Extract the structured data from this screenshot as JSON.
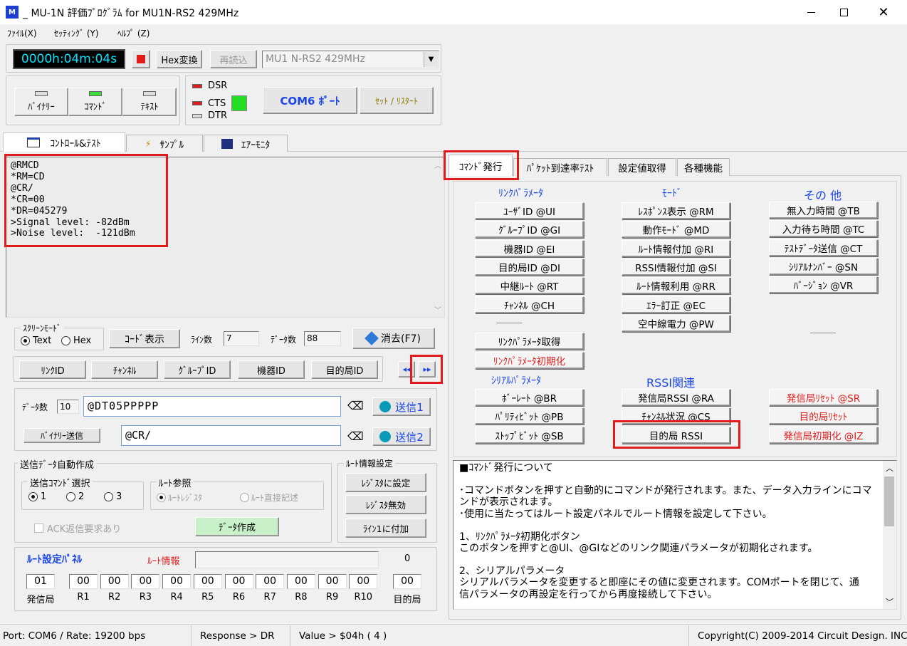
{
  "title_bar": {
    "title": "_ MU-1N 評価ﾌﾟﾛｸﾞﾗﾑ for MU1N-RS2 429MHz"
  },
  "menu": [
    "ﾌｧｲﾙ(X)",
    "ｾｯﾃｨﾝｸﾞ (Y)",
    "ﾍﾙﾌﾟ (Z)"
  ],
  "toolbar": {
    "timer": "0000h:04m:04s",
    "hex_button": "Hex変換",
    "reload_button": "再読込",
    "device_select": "MU1 N-RS2 429MHz"
  },
  "mode_buttons": [
    "ﾊﾞｲﾅﾘｰ",
    "ｺﾏﾝﾄﾞ",
    "ﾃｷｽﾄ"
  ],
  "signals": {
    "dsr": "DSR",
    "cts": "CTS",
    "dtr": "DTR"
  },
  "com": {
    "port_button": "COM6 ﾎﾟｰﾄ",
    "reset_button": "ｾｯﾄ / ﾘｽﾀｰﾄ"
  },
  "main_tabs": [
    "ｺﾝﾄﾛｰﾙ&ﾃｽﾄ",
    "ｻﾝﾌﾟﾙ",
    "ｴｱｰﾓﾆﾀ"
  ],
  "console": {
    "lines": [
      "@RMCD",
      "*RM=CD",
      "@CR/",
      "*CR=00",
      "*DR=045279",
      ">Signal level: -82dBm",
      ">Noise level:  -121dBm"
    ]
  },
  "screen_mode": {
    "title": "ｽｸﾘｰﾝﾓｰﾄﾞ",
    "text": "Text",
    "hex": "Hex",
    "code_button": "ｺｰﾄﾞ表示",
    "lines_label": "ﾗｲﾝ数",
    "lines_value": "7",
    "data_label": "ﾃﾞｰﾀ数",
    "data_value": "88",
    "clear_button": "消去(F7)"
  },
  "quick_buttons": [
    "ﾘﾝｸID",
    "ﾁｬﾝﾈﾙ",
    "ｸﾞﾙｰﾌﾟID",
    "機器ID",
    "目的局ID"
  ],
  "nav": {
    "prev": "◂◂",
    "next": "▸▸"
  },
  "send": {
    "count_label": "ﾃﾞｰﾀ数",
    "count_value": "10",
    "input1": "@DT05PPPPP",
    "send1": "送信1",
    "binary_button": "ﾊﾞｲﾅﾘｰ送信",
    "input2": "@CR/",
    "send2": "送信2"
  },
  "auto": {
    "title": "送信ﾃﾞｰﾀ自動作成",
    "cmd_title": "送信ｺﾏﾝﾄﾞ選択",
    "opts": [
      "1",
      "2",
      "3"
    ],
    "route_title": "ﾙｰﾄ参照",
    "route_opt1": "ﾙｰﾄﾚｼﾞｽﾀ",
    "route_opt2": "ﾙｰﾄ直接記述",
    "ack": "ACK返信要求あり",
    "make_button": "ﾃﾞｰﾀ作成"
  },
  "route_settings": {
    "title": "ﾙｰﾄ情報設定",
    "b1": "ﾚｼﾞｽﾀに設定",
    "b2": "ﾚｼﾞｽﾀ無効",
    "b3": "ﾗｲﾝ1に付加"
  },
  "route_panel": {
    "title": "ﾙｰﾄ設定ﾊﾟﾈﾙ",
    "info_label": "ﾙｰﾄ情報",
    "count": "0",
    "source_value": "01",
    "source_label": "発信局",
    "relays": [
      {
        "v": "00",
        "l": "R1"
      },
      {
        "v": "00",
        "l": "R2"
      },
      {
        "v": "00",
        "l": "R3"
      },
      {
        "v": "00",
        "l": "R4"
      },
      {
        "v": "00",
        "l": "R5"
      },
      {
        "v": "00",
        "l": "R6"
      },
      {
        "v": "00",
        "l": "R7"
      },
      {
        "v": "00",
        "l": "R8"
      },
      {
        "v": "00",
        "l": "R9"
      },
      {
        "v": "00",
        "l": "R10"
      }
    ],
    "dest_value": "00",
    "dest_label": "目的局"
  },
  "right_tabs": [
    "ｺﾏﾝﾄﾞ発行",
    "ﾊﾟｹｯﾄ到達率ﾃｽﾄ",
    "設定値取得",
    "各種機能"
  ],
  "cmd_panel": {
    "link_header": "ﾘﾝｸﾊﾟﾗﾒｰﾀ",
    "mode_header": "ﾓｰﾄﾞ",
    "other_header": "その 他",
    "serial_header": "ｼﾘｱﾙﾊﾟﾗﾒｰﾀ",
    "rssi_header": "RSSI関連",
    "link": [
      "ﾕｰｻﾞID @UI",
      "ｸﾞﾙｰﾌﾟID @GI",
      "機器ID @EI",
      "目的局ID @DI",
      "中継ﾙｰﾄ @RT",
      "ﾁｬﾝﾈﾙ @CH"
    ],
    "mode": [
      "ﾚｽﾎﾟﾝｽ表示 @RM",
      "動作ﾓｰﾄﾞ @MD",
      "ﾙｰﾄ情報付加 @RI",
      "RSSI情報付加 @SI",
      "ﾙｰﾄ情報利用 @RR",
      "ｴﾗｰ訂正 @EC",
      "空中線電力 @PW"
    ],
    "other": [
      "無入力時間 @TB",
      "入力待ち時間 @TC",
      "ﾃｽﾄﾃﾞｰﾀ送信 @CT",
      "ｼﾘｱﾙﾅﾝﾊﾞｰ @SN",
      "ﾊﾞｰｼﾞｮﾝ @VR"
    ],
    "link_get": "ﾘﾝｸﾊﾟﾗﾒｰﾀ取得",
    "link_init": "ﾘﾝｸﾊﾟﾗﾒｰﾀ初期化",
    "serial": [
      "ﾎﾞｰﾚｰﾄ @BR",
      "ﾊﾟﾘﾃｨﾋﾞｯﾄ @PB",
      "ｽﾄｯﾌﾟﾋﾞｯﾄ @SB"
    ],
    "rssi": [
      "発信局RSSI @RA",
      "ﾁｬﾝﾈﾙ状況 @CS",
      "目的局 RSSI"
    ],
    "reset": [
      "発信局ﾘｾｯﾄ @SR",
      "目的局ﾘｾｯﾄ",
      "発信局初期化 @IZ"
    ]
  },
  "help": {
    "lines": [
      "■ｺﾏﾝﾄﾞ発行について",
      "",
      "･コマンドボタンを押すと自動的にコマンドが発行されます。また、データ入力ラインにコマ",
      "ンドが表示されます。",
      "･使用に当たってはルート設定パネルでルート情報を設定して下さい。",
      "",
      "1、ﾘﾝｸﾊﾟﾗﾒｰﾀ初期化ボタン",
      "このボタンを押すと@UI、@GIなどのリンク関連パラメータが初期化されます。",
      "",
      "2、シリアルパラメータ",
      "シリアルパラメータを変更すると即座にその値に変更されます。COMポートを閉じて、通",
      "信パラメータの再設定を行ってから再度接続して下さい。"
    ]
  },
  "status": {
    "port": "Port: COM6 / Rate: 19200 bps",
    "response": "Response > DR",
    "value": "Value > $04h ( 4 )",
    "copyright": "Copyright(C) 2009-2014 Circuit Design. INC."
  },
  "colors": {
    "accent_blue": "#1a45e8",
    "highlight_red": "#e01b1b",
    "timer_bg": "#000000",
    "timer_fg": "#00e5ff",
    "cts_green": "#22dd22"
  }
}
